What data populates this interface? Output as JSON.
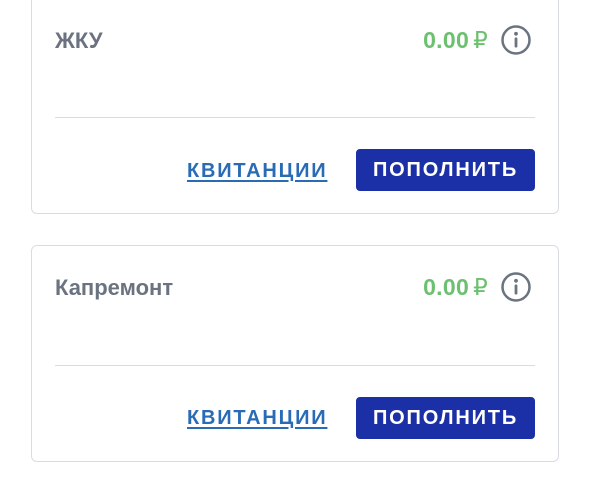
{
  "colors": {
    "title": "#6b7380",
    "amount": "#6cc070",
    "link": "#2a6bb5",
    "button_bg": "#1b2fa6",
    "button_text": "#ffffff",
    "border": "#d9dde3"
  },
  "cards": [
    {
      "title": "ЖКУ",
      "amount": "0.00",
      "currency": "₽",
      "info_icon": "info-circle-icon",
      "receipts_label": "КВИТАНЦИИ",
      "topup_label": "ПОПОЛНИТЬ"
    },
    {
      "title": "Капремонт",
      "amount": "0.00",
      "currency": "₽",
      "info_icon": "info-circle-icon",
      "receipts_label": "КВИТАНЦИИ",
      "topup_label": "ПОПОЛНИТЬ"
    }
  ]
}
